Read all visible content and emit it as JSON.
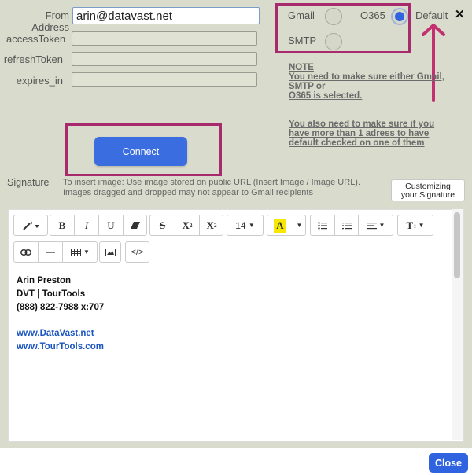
{
  "form": {
    "from_address_label": "From Address",
    "from_address_value": "arin@datavast.net",
    "access_token_label": "accessToken",
    "refresh_token_label": "refreshToken",
    "expires_in_label": "expires_in"
  },
  "provider": {
    "gmail_label": "Gmail",
    "o365_label": "O365",
    "smtp_label": "SMTP",
    "default_label": "Default",
    "selected": "O365",
    "close_glyph": "✕"
  },
  "notes": {
    "line1": "NOTE",
    "line2": "You need to make sure either Gmail,",
    "line3": "SMTP or",
    "line4": "O365 is selected.",
    "line5": "You also need to make sure if you",
    "line6": "have more than 1 adress to have",
    "line7": "default checked on one of them"
  },
  "connect_label": "Connect",
  "signature": {
    "label": "Signature",
    "help": "To insert image: Use image stored on public URL (Insert Image / Image URL). Images dragged and dropped may not appear to Gmail recipients",
    "customize_label": "Customizing your Signature"
  },
  "toolbar": {
    "font_size": "14",
    "bold": "B",
    "italic": "I",
    "underline": "U",
    "strike": "S",
    "superscript": "X",
    "subscript": "X",
    "color_letter": "A",
    "line_height": "T",
    "code": "</>",
    "highlight_color": "#f6e800"
  },
  "editor_content": {
    "line1": "Arin Preston",
    "line2": "DVT | TourTools",
    "line3": "(888) 822-7988 x:707",
    "link1": "www.DataVast.net",
    "link2": "www.TourTools.com"
  },
  "close_label": "Close",
  "colors": {
    "accent": "#3a6ee0",
    "highlight_box": "#a72a6d",
    "arrow": "#c2306f",
    "link": "#1a55c0"
  }
}
